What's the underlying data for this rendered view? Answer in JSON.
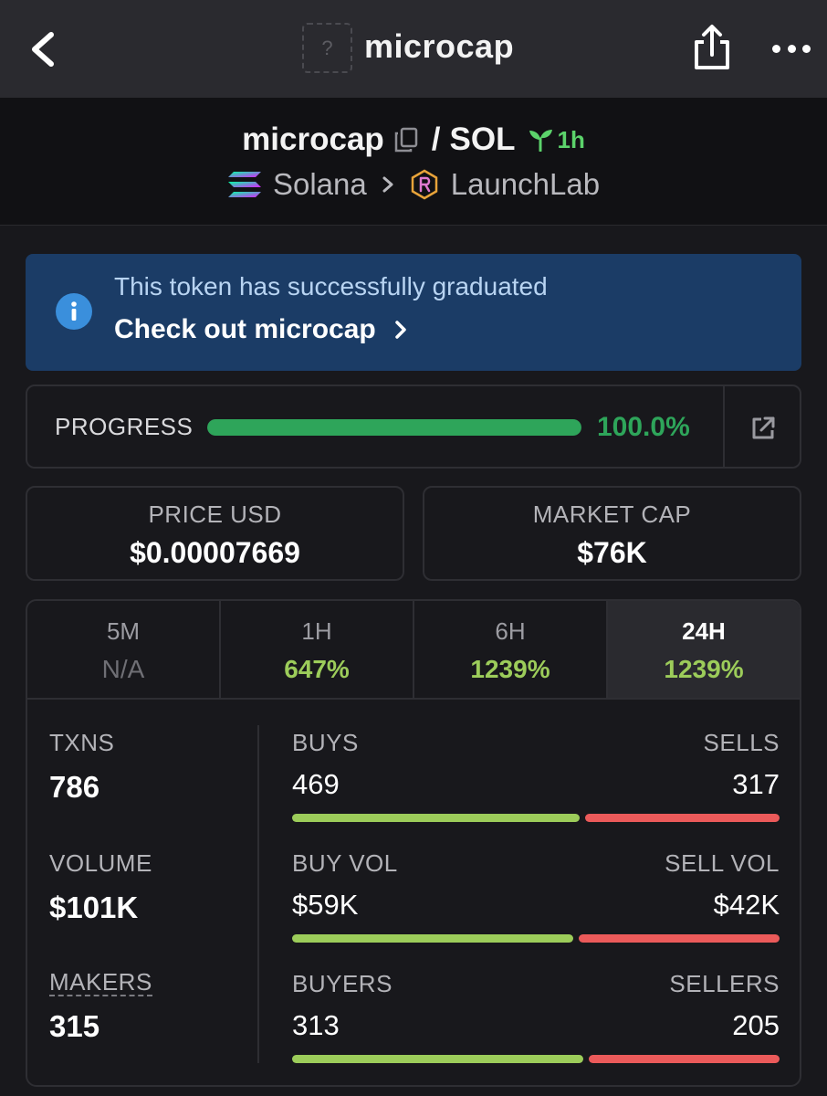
{
  "topbar": {
    "title": "microcap",
    "token_placeholder": "?",
    "back_icon": "chevron-left-icon",
    "share_icon": "share-icon",
    "more_icon": "more-horizontal-icon"
  },
  "pair": {
    "base": "microcap",
    "separator": "/",
    "quote": "SOL",
    "age": "1h",
    "chain": "Solana",
    "dex": "LaunchLab"
  },
  "banner": {
    "message": "This token has successfully graduated",
    "link_label": "Check out microcap",
    "color": "#1b3c66"
  },
  "progress": {
    "label": "PROGRESS",
    "value_text": "100.0%",
    "fraction": 1.0,
    "color": "#2ea55a"
  },
  "price": {
    "label": "PRICE USD",
    "value": "$0.00007669"
  },
  "market_cap": {
    "label": "MARKET CAP",
    "value": "$76K"
  },
  "timeframes": [
    {
      "label": "5M",
      "value": "N/A"
    },
    {
      "label": "1H",
      "value": "647%"
    },
    {
      "label": "6H",
      "value": "1239%"
    },
    {
      "label": "24H",
      "value": "1239%"
    }
  ],
  "active_timeframe": "24H",
  "stats": {
    "txns": {
      "label": "TXNS",
      "value": "786"
    },
    "volume": {
      "label": "VOLUME",
      "value": "$101K"
    },
    "makers": {
      "label": "MAKERS",
      "value": "315"
    },
    "buys": {
      "label": "BUYS",
      "value": "469",
      "sell_label": "SELLS",
      "sell_value": "317",
      "buy_n": 469,
      "sell_n": 317
    },
    "vol": {
      "label": "BUY VOL",
      "value": "$59K",
      "sell_label": "SELL VOL",
      "sell_value": "$42K",
      "buy_n": 59,
      "sell_n": 42
    },
    "buyers": {
      "label": "BUYERS",
      "value": "313",
      "sell_label": "SELLERS",
      "sell_value": "205",
      "buy_n": 313,
      "sell_n": 205
    }
  },
  "colors": {
    "positive": "#9ccc5a",
    "negative": "#eb5a5a",
    "age": "#5cd36b"
  }
}
